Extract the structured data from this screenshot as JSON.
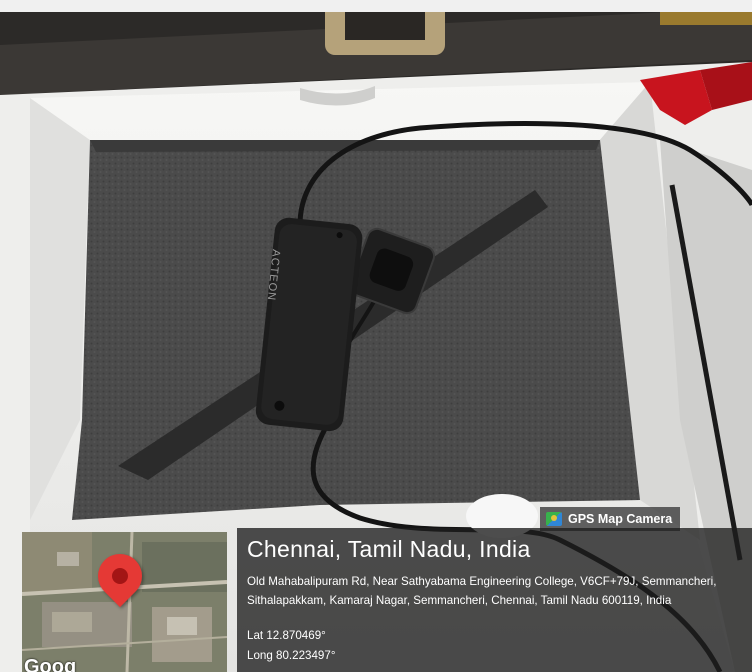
{
  "camera_badge": {
    "label": "GPS Map Camera",
    "icon": "gps-map-camera-icon"
  },
  "location": {
    "title": "Chennai, Tamil Nadu, India",
    "address": "Old Mahabalipuram Rd, Near Sathyabama Engineering College, V6CF+79J, Semmancheri, Sithalapakkam, Kamaraj Nagar, Semmancheri, Chennai, Tamil Nadu 600119, India",
    "lat": "Lat 12.870469°",
    "long": "Long 80.223497°"
  },
  "map_thumbnail": {
    "pin_icon": "map-pin-icon",
    "attribution": "Goog",
    "pin_color": "#e53935"
  },
  "sensor_label": "ACTEON",
  "colors": {
    "box_white": "#f4f4f2",
    "foam": "#4a4a4a",
    "device": "#1c1c1c",
    "clip_red": "#c8141e"
  }
}
